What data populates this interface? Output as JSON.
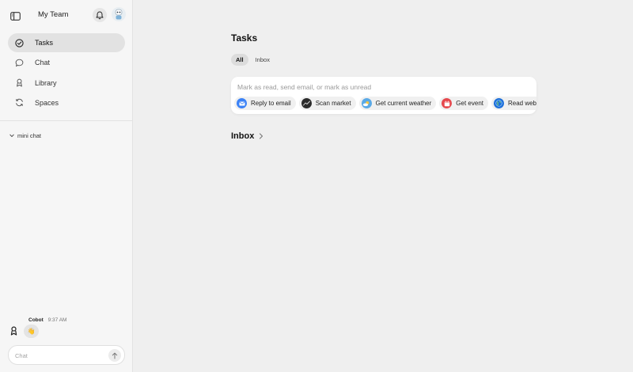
{
  "sidebar": {
    "team_name": "My Team",
    "nav": [
      {
        "label": "Tasks",
        "icon": "check-circle-icon",
        "active": true
      },
      {
        "label": "Chat",
        "icon": "chat-bubble-icon",
        "active": false
      },
      {
        "label": "Library",
        "icon": "library-icon",
        "active": false
      },
      {
        "label": "Spaces",
        "icon": "spaces-icon",
        "active": false
      }
    ],
    "mini_chat_label": "mini chat"
  },
  "mini_chat": {
    "sender": "Cobot",
    "time": "9:37 AM",
    "message_emoji": "👋",
    "input_placeholder": "Chat"
  },
  "main": {
    "title": "Tasks",
    "tabs": [
      {
        "label": "All",
        "active": true
      },
      {
        "label": "Inbox",
        "active": false
      }
    ],
    "composer": {
      "placeholder": "Mark as read, send email, or mark as unread",
      "suggestions": [
        {
          "label": "Reply to email",
          "icon": "mail-icon",
          "color": "#3b82f6"
        },
        {
          "label": "Scan market",
          "icon": "market-icon",
          "color": "#2b2b2b"
        },
        {
          "label": "Get current weather",
          "icon": "weather-icon",
          "color": "#5aa9e6"
        },
        {
          "label": "Get event",
          "icon": "calendar-icon",
          "color": "#e5484d"
        },
        {
          "label": "Read web page",
          "icon": "globe-icon",
          "color": "#1e6fd9"
        }
      ]
    },
    "inbox_section_title": "Inbox"
  },
  "colors": {
    "sidebar_bg": "#f6f6f6",
    "main_bg": "#efefef",
    "active_nav": "#e2e2e2"
  }
}
